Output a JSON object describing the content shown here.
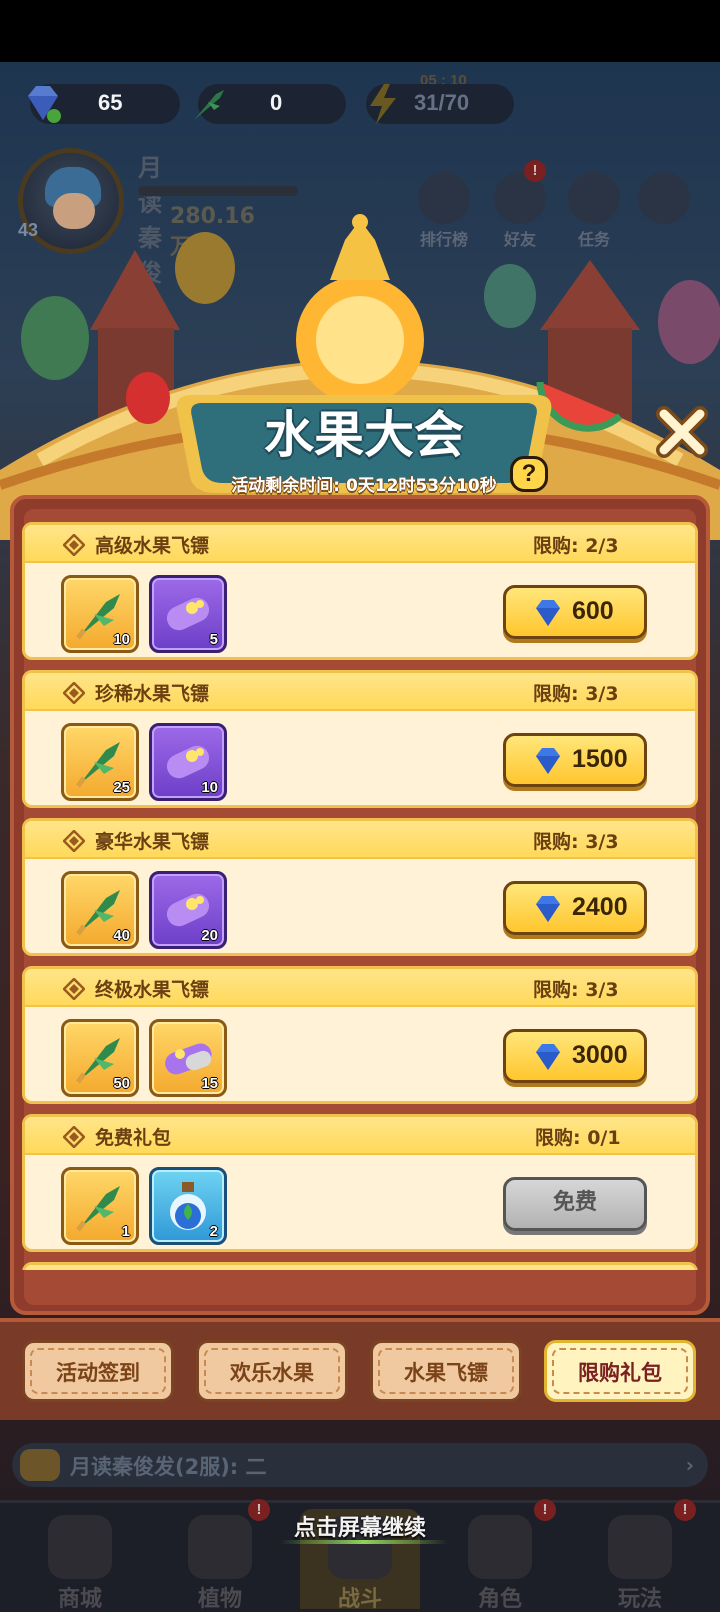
{
  "hud": {
    "gems": "65",
    "darts": "0",
    "energy": "31/70",
    "energy_timer": "05 : 10"
  },
  "profile": {
    "name": "月读秦俊发",
    "level": "43",
    "power": "280.16万"
  },
  "top_menu": [
    {
      "label": "排行榜",
      "icon": "leaderboard-icon"
    },
    {
      "label": "好友",
      "icon": "friends-icon",
      "badge": "!"
    },
    {
      "label": "任务",
      "icon": "tasks-icon"
    },
    {
      "label": "",
      "icon": "clover-icon"
    }
  ],
  "modal": {
    "title": "水果大会",
    "timer": "活动剩余时间: 0天12时53分10秒",
    "help_label": "?"
  },
  "packs": [
    {
      "name": "高级水果飞镖",
      "limit": "限购: 2/3",
      "dart_qty": "10",
      "second_item": "purple-capsule",
      "second_qty": "5",
      "price": "600",
      "free": false
    },
    {
      "name": "珍稀水果飞镖",
      "limit": "限购: 3/3",
      "dart_qty": "25",
      "second_item": "purple-capsule",
      "second_qty": "10",
      "price": "1500",
      "free": false
    },
    {
      "name": "豪华水果飞镖",
      "limit": "限购: 3/3",
      "dart_qty": "40",
      "second_item": "purple-capsule",
      "second_qty": "20",
      "price": "2400",
      "free": false
    },
    {
      "name": "终极水果飞镖",
      "limit": "限购: 3/3",
      "dart_qty": "50",
      "second_item": "gold-capsule",
      "second_qty": "15",
      "price": "3000",
      "free": false
    },
    {
      "name": "免费礼包",
      "limit": "限购: 0/1",
      "dart_qty": "1",
      "second_item": "blue-potion",
      "second_qty": "2",
      "price": "免费",
      "free": true
    }
  ],
  "tabs": [
    {
      "label": "活动签到",
      "active": false
    },
    {
      "label": "欢乐水果",
      "active": false
    },
    {
      "label": "水果飞镖",
      "active": false
    },
    {
      "label": "限购礼包",
      "active": true
    }
  ],
  "chat": {
    "text": "月读秦俊发(2服): 二",
    "arrow": "›"
  },
  "nav": [
    {
      "label": "商城",
      "badge": ""
    },
    {
      "label": "植物",
      "badge": "!"
    },
    {
      "label": "战斗",
      "badge": ""
    },
    {
      "label": "角色",
      "badge": "!"
    },
    {
      "label": "玩法",
      "badge": "!"
    }
  ],
  "continue_hint": "点击屏幕继续",
  "colors": {
    "gold": "#ffc62e",
    "panel": "#a54a34",
    "cream": "#fff2d6",
    "teal_plate": "#2f6f7c"
  }
}
